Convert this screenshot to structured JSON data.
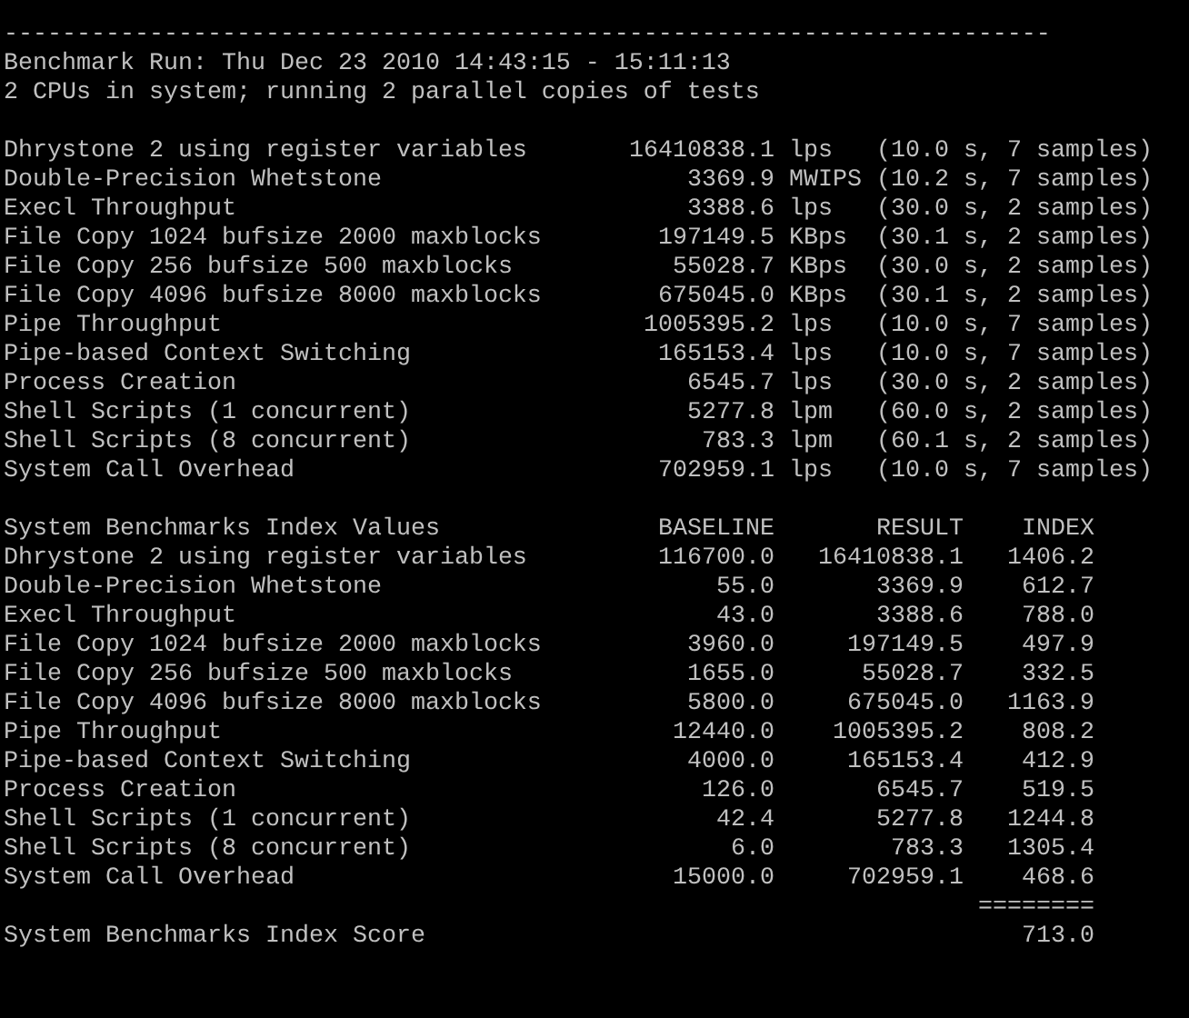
{
  "terminal": {
    "rule": "------------------------------------------------------------------------",
    "header_lines": [
      "Benchmark Run: Thu Dec 23 2010 14:43:15 - 15:11:13",
      "2 CPUs in system; running 2 parallel copies of tests"
    ],
    "results": [
      {
        "name": "Dhrystone 2 using register variables",
        "value": "16410838.1",
        "unit": "lps",
        "detail": "(10.0 s, 7 samples)"
      },
      {
        "name": "Double-Precision Whetstone",
        "value": "3369.9",
        "unit": "MWIPS",
        "detail": "(10.2 s, 7 samples)"
      },
      {
        "name": "Execl Throughput",
        "value": "3388.6",
        "unit": "lps",
        "detail": "(30.0 s, 2 samples)"
      },
      {
        "name": "File Copy 1024 bufsize 2000 maxblocks",
        "value": "197149.5",
        "unit": "KBps",
        "detail": "(30.1 s, 2 samples)"
      },
      {
        "name": "File Copy 256 bufsize 500 maxblocks",
        "value": "55028.7",
        "unit": "KBps",
        "detail": "(30.0 s, 2 samples)"
      },
      {
        "name": "File Copy 4096 bufsize 8000 maxblocks",
        "value": "675045.0",
        "unit": "KBps",
        "detail": "(30.1 s, 2 samples)"
      },
      {
        "name": "Pipe Throughput",
        "value": "1005395.2",
        "unit": "lps",
        "detail": "(10.0 s, 7 samples)"
      },
      {
        "name": "Pipe-based Context Switching",
        "value": "165153.4",
        "unit": "lps",
        "detail": "(10.0 s, 7 samples)"
      },
      {
        "name": "Process Creation",
        "value": "6545.7",
        "unit": "lps",
        "detail": "(30.0 s, 2 samples)"
      },
      {
        "name": "Shell Scripts (1 concurrent)",
        "value": "5277.8",
        "unit": "lpm",
        "detail": "(60.0 s, 2 samples)"
      },
      {
        "name": "Shell Scripts (8 concurrent)",
        "value": "783.3",
        "unit": "lpm",
        "detail": "(60.1 s, 2 samples)"
      },
      {
        "name": "System Call Overhead",
        "value": "702959.1",
        "unit": "lps",
        "detail": "(10.0 s, 7 samples)"
      }
    ],
    "index_table": {
      "columns": [
        "System Benchmarks Index Values",
        "BASELINE",
        "RESULT",
        "INDEX"
      ],
      "rows": [
        [
          "Dhrystone 2 using register variables",
          "116700.0",
          "16410838.1",
          "1406.2"
        ],
        [
          "Double-Precision Whetstone",
          "55.0",
          "3369.9",
          "612.7"
        ],
        [
          "Execl Throughput",
          "43.0",
          "3388.6",
          "788.0"
        ],
        [
          "File Copy 1024 bufsize 2000 maxblocks",
          "3960.0",
          "197149.5",
          "497.9"
        ],
        [
          "File Copy 256 bufsize 500 maxblocks",
          "1655.0",
          "55028.7",
          "332.5"
        ],
        [
          "File Copy 4096 bufsize 8000 maxblocks",
          "5800.0",
          "675045.0",
          "1163.9"
        ],
        [
          "Pipe Throughput",
          "12440.0",
          "1005395.2",
          "808.2"
        ],
        [
          "Pipe-based Context Switching",
          "4000.0",
          "165153.4",
          "412.9"
        ],
        [
          "Process Creation",
          "126.0",
          "6545.7",
          "519.5"
        ],
        [
          "Shell Scripts (1 concurrent)",
          "42.4",
          "5277.8",
          "1244.8"
        ],
        [
          "Shell Scripts (8 concurrent)",
          "6.0",
          "783.3",
          "1305.4"
        ],
        [
          "System Call Overhead",
          "15000.0",
          "702959.1",
          "468.6"
        ]
      ],
      "separator": "========",
      "score_label": "System Benchmarks Index Score",
      "score": "713.0"
    }
  }
}
